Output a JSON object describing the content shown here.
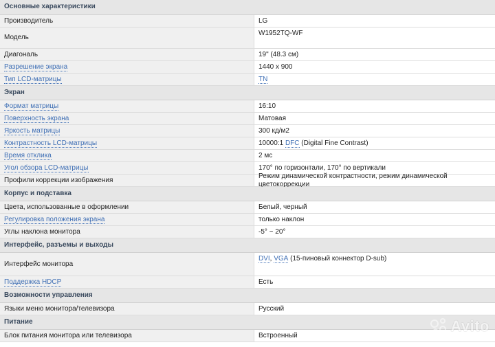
{
  "sections": [
    {
      "title": "Основные характеристики",
      "rows": [
        {
          "label": "Производитель",
          "value": "LG"
        },
        {
          "label": "Модель",
          "value": "W1952TQ-WF"
        },
        {
          "label": "Диагональ",
          "value": "19\" (48.3 см)"
        },
        {
          "label": "Разрешение экрана",
          "value": "1440 x 900"
        },
        {
          "label": "Тип LCD-матрицы",
          "value": "TN"
        }
      ]
    },
    {
      "title": "Экран",
      "rows": [
        {
          "label": "Формат матрицы",
          "value": "16:10"
        },
        {
          "label": "Поверхность экрана",
          "value": "Матовая"
        },
        {
          "label": "Яркость матрицы",
          "value": "300 кд/м2"
        },
        {
          "label": "Контрастность LCD-матрицы",
          "value": "10000:1",
          "value_link": "DFC",
          "value_suffix": "(Digital Fine Contrast)"
        },
        {
          "label": "Время отклика",
          "value": "2 мс"
        },
        {
          "label": "Угол обзора LCD-матрицы",
          "value": "170° по горизонтали, 170° по вертикали"
        },
        {
          "label": "Профили коррекции изображения",
          "value": "Режим динамической контрастности, режим динамической цветокоррекции"
        }
      ]
    },
    {
      "title": "Корпус и подставка",
      "rows": [
        {
          "label": "Цвета, использованные в оформлении",
          "value": "Белый, черный"
        },
        {
          "label": "Регулировка положения экрана",
          "value": "только наклон"
        },
        {
          "label": "Углы наклона монитора",
          "value": "-5° ~ 20°"
        }
      ]
    },
    {
      "title": "Интерфейс, разъемы и выходы",
      "rows": [
        {
          "label": "Интерфейс монитора",
          "value_link": "DVI",
          "value_sep": ",",
          "value_link2": "VGA",
          "value_suffix": "(15-пиновый коннектор D-sub)"
        },
        {
          "label": "Поддержка HDCP",
          "value": "Есть"
        }
      ]
    },
    {
      "title": "Возможности управления",
      "rows": [
        {
          "label": "Языки меню монитора/телевизора",
          "value": "Русский"
        }
      ]
    },
    {
      "title": "Питание",
      "rows": [
        {
          "label": "Блок питания монитора или телевизора",
          "value": "Встроенный"
        }
      ]
    }
  ],
  "watermark": {
    "text": "Avito"
  }
}
